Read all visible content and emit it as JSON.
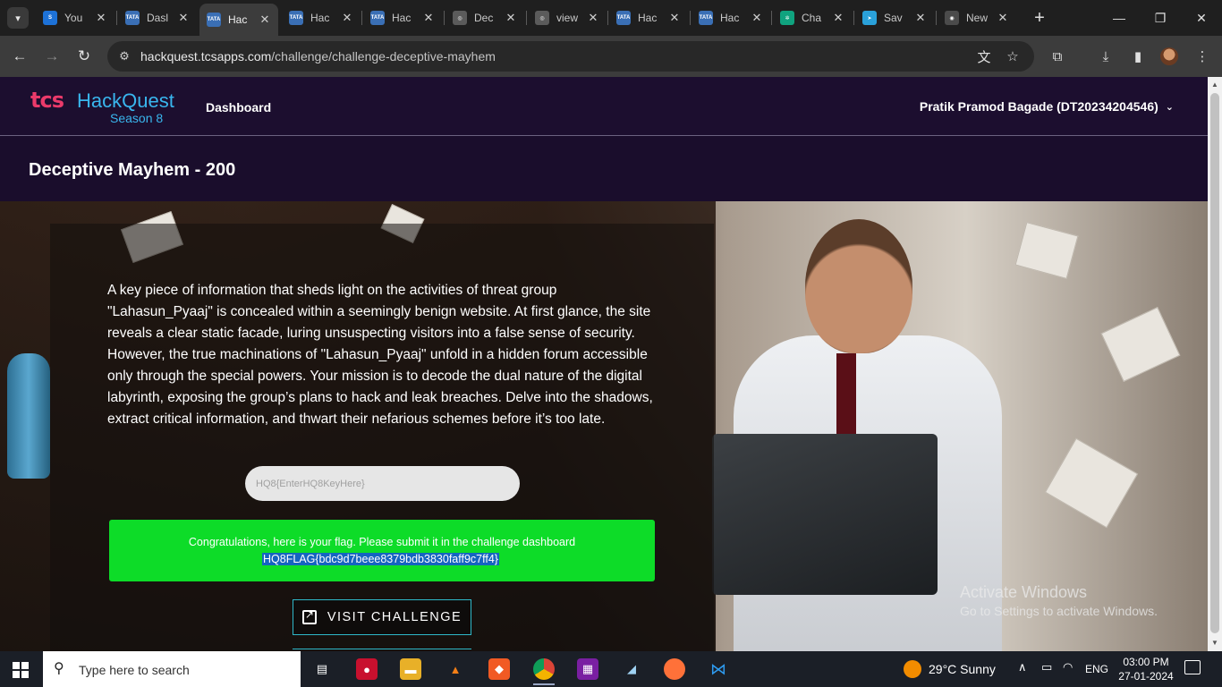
{
  "browser": {
    "tabs": [
      {
        "label": "You",
        "favicon_text": "S",
        "favicon_color": "#1d72d8"
      },
      {
        "label": "Dasl",
        "favicon_text": "TATA",
        "favicon_color": "#3a6fb5"
      },
      {
        "label": "Hac",
        "favicon_text": "TATA",
        "favicon_color": "#3a6fb5",
        "active": true
      },
      {
        "label": "Hac",
        "favicon_text": "TATA",
        "favicon_color": "#3a6fb5"
      },
      {
        "label": "Hac",
        "favicon_text": "TATA",
        "favicon_color": "#3a6fb5"
      },
      {
        "label": "Dec",
        "favicon_text": "◎",
        "favicon_color": "#5b5b5b"
      },
      {
        "label": "view",
        "favicon_text": "◎",
        "favicon_color": "#5b5b5b"
      },
      {
        "label": "Hac",
        "favicon_text": "TATA",
        "favicon_color": "#3a6fb5"
      },
      {
        "label": "Hac",
        "favicon_text": "TATA",
        "favicon_color": "#3a6fb5"
      },
      {
        "label": "Cha",
        "favicon_text": "✲",
        "favicon_color": "#10a37f"
      },
      {
        "label": "Sav",
        "favicon_text": "➤",
        "favicon_color": "#2aa1da"
      },
      {
        "label": "New",
        "favicon_text": "◉",
        "favicon_color": "#4b4b4b"
      }
    ],
    "url_host": "hackquest.tcsapps.com",
    "url_path": "/challenge/challenge-deceptive-mayhem",
    "new_tab_symbol": "+"
  },
  "site": {
    "logo_tcs": "tcs",
    "logo_name": "HackQuest",
    "logo_season": "Season 8",
    "nav_dashboard": "Dashboard",
    "user_name": "Pratik Pramod Bagade (DT20234204546)"
  },
  "challenge": {
    "title": "Deceptive Mayhem - 200",
    "description": "A key piece of information that sheds light on the activities of threat group \"Lahasun_Pyaaj\" is concealed within a seemingly benign website. At first glance, the site reveals a clear static facade, luring unsuspecting visitors into a false sense of security. However, the true machinations of \"Lahasun_Pyaaj\" unfold in a hidden forum accessible only through the special powers. Your mission is to decode the dual nature of the digital labyrinth, exposing the group’s plans to hack and leak breaches. Delve into the shadows, extract critical information, and thwart their nefarious schemes before it’s too late.",
    "flag_placeholder": "HQ8{EnterHQ8KeyHere}",
    "success_message": "Congratulations, here is your flag. Please submit it in the challenge dashboard",
    "flag_value": "HQ8FLAG{bdc9d7beee8379bdb3830faff9c7ff4}",
    "visit_button": "VISIT CHALLENGE"
  },
  "watermark": {
    "line1": "Activate Windows",
    "line2": "Go to Settings to activate Windows."
  },
  "taskbar": {
    "search_placeholder": "Type here to search",
    "weather": "29°C  Sunny",
    "language": "ENG",
    "time": "03:00 PM",
    "date": "27-01-2024"
  },
  "colors": {
    "header_bg": "#1c0e2f",
    "success_bg": "#0ddc28",
    "flag_highlight": "#1564c0",
    "button_border": "#2fb8c9"
  }
}
